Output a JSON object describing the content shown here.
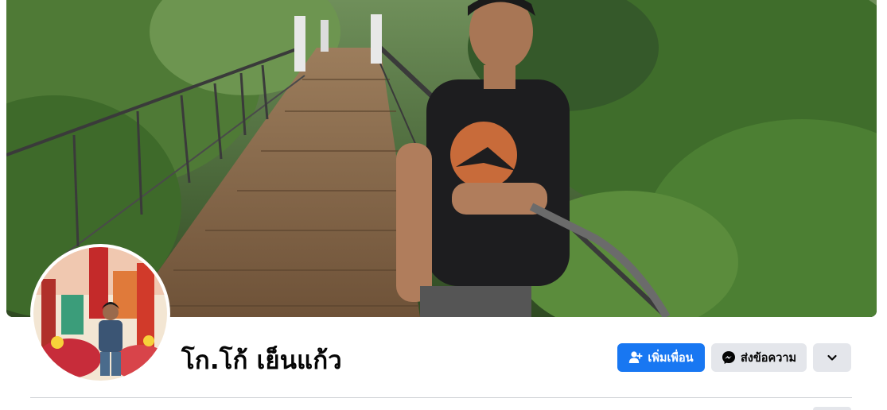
{
  "profile": {
    "name": "โก.โก้ เย็นแก้ว"
  },
  "actions": {
    "add_friend_label": "เพิ่มเพื่อน",
    "message_label": "ส่งข้อความ"
  },
  "icons": {
    "add_friend": "add-person-icon",
    "message": "messenger-icon",
    "more": "chevron-down-icon"
  },
  "colors": {
    "primary": "#1877f2",
    "secondary_button": "#e4e6eb",
    "text": "#050505",
    "divider": "#ced0d4"
  }
}
